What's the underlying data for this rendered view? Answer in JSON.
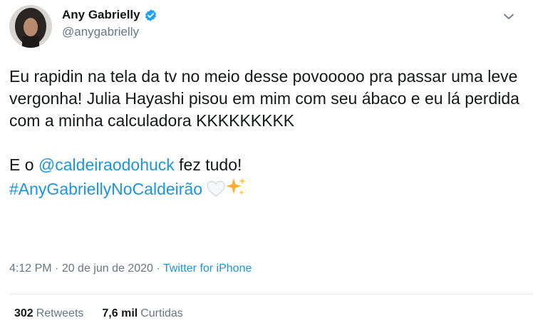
{
  "author": {
    "display_name": "Any Gabrielly",
    "handle": "@anygabrielly",
    "verified": true
  },
  "tweet": {
    "paragraph1": "Eu rapidin na tela da tv no meio desse povooooo pra passar uma leve vergonha! Julia Hayashi pisou em mim com seu ábaco e eu lá perdida com a minha calculadora KKKKKKKKK",
    "p2_prefix": "E o ",
    "mention": "@caldeiraodohuck",
    "p2_suffix": " fez tudo!",
    "hashtag": "#AnyGabriellyNoCaldeirão",
    "emojis": [
      "white-heart",
      "sparkles"
    ]
  },
  "meta": {
    "time": "4:12 PM",
    "separator": " · ",
    "date": "20 de jun de 2020",
    "source": "Twitter for iPhone"
  },
  "stats": {
    "retweets_count": "302",
    "retweets_label": "Retweets",
    "likes_count": "7,6 mil",
    "likes_label": "Curtidas"
  },
  "colors": {
    "link": "#1b95e0",
    "secondary_text": "#657786",
    "verified_badge": "#1da1f2"
  }
}
